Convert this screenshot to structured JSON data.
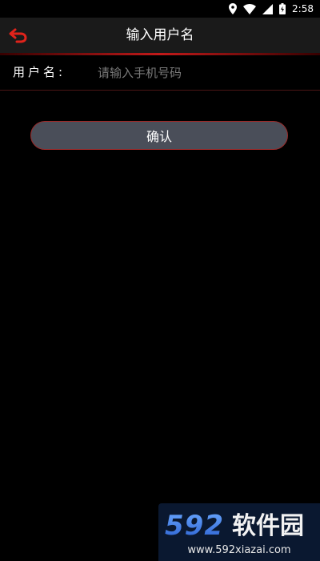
{
  "status_bar": {
    "time": "2:58",
    "icons": [
      "location-icon",
      "wifi-icon",
      "signal-icon",
      "battery-icon"
    ]
  },
  "header": {
    "title": "输入用户名",
    "back_icon": "back-arrow-icon",
    "accent_color": "#e0231b"
  },
  "form": {
    "username_label": "用户名:",
    "username_placeholder": "请输入手机号码",
    "username_value": ""
  },
  "actions": {
    "confirm_label": "确认"
  },
  "watermark": {
    "logo_text": "592软件园",
    "url": "www.592xiazai.com"
  }
}
